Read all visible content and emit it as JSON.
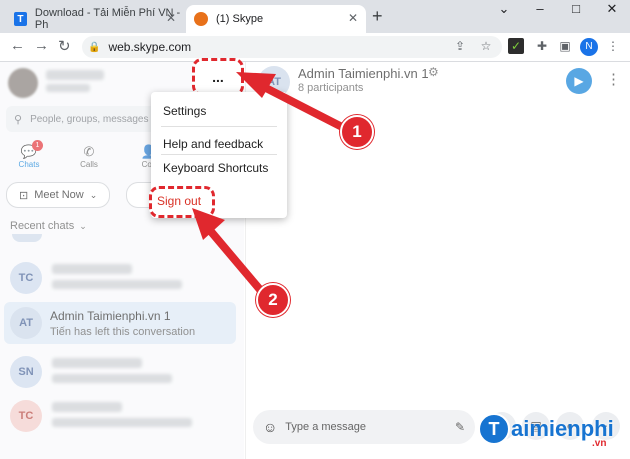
{
  "browser": {
    "tabs": [
      {
        "title": "Download - Tải Miễn Phí VN - Ph",
        "favicon": "T"
      },
      {
        "title": "(1) Skype"
      }
    ],
    "new_tab": "+",
    "url": "web.skype.com",
    "profile_initial": "N",
    "window_controls": [
      "⌄",
      "–",
      "□",
      "✕"
    ]
  },
  "sidebar": {
    "search_placeholder": "People, groups, messages",
    "nav": [
      {
        "label": "Chats",
        "badge": "1"
      },
      {
        "label": "Calls"
      },
      {
        "label": "Con"
      }
    ],
    "meet_now": "Meet Now",
    "recent_chats_label": "Recent chats",
    "chats": [
      {
        "initials": "TC"
      },
      {
        "initials": "AT",
        "title": "Admin Taimienphi.vn 1",
        "subtitle": "Tiến has left this conversation"
      },
      {
        "initials": "SN"
      },
      {
        "initials": "TC"
      }
    ]
  },
  "conversation": {
    "initials": "AT",
    "title": "Admin Taimienphi.vn 1",
    "participants": "8 participants",
    "message_placeholder": "Type a message"
  },
  "menu": {
    "dots": "...",
    "items": [
      "Settings",
      "Help and feedback",
      "Keyboard Shortcuts",
      "Sign out"
    ]
  },
  "annotations": {
    "step1": "1",
    "step2": "2"
  },
  "watermark": {
    "brand": "aimienphi",
    "tld": ".vn"
  },
  "colors": {
    "accent": "#0078d4",
    "annotation": "#e0282e"
  }
}
